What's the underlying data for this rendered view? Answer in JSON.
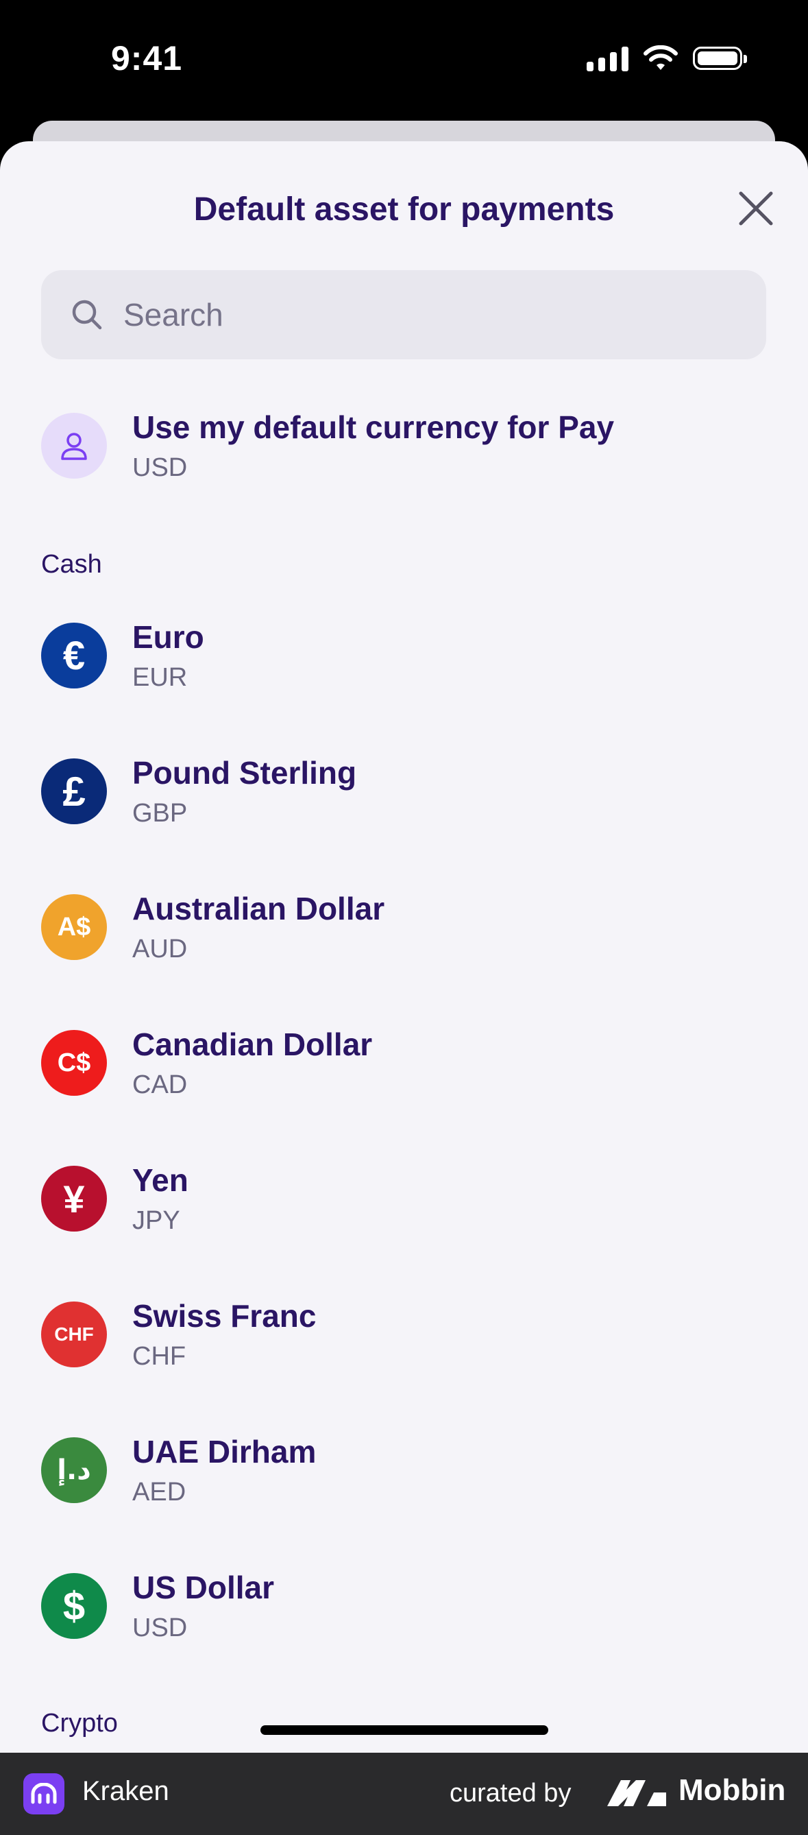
{
  "status_bar": {
    "time": "9:41"
  },
  "sheet": {
    "title": "Default asset for payments",
    "search": {
      "placeholder": "Search",
      "value": ""
    }
  },
  "default_option": {
    "label": "Use my default currency for Pay",
    "code": "USD",
    "icon": "person-icon"
  },
  "sections": {
    "cash": "Cash",
    "crypto": "Crypto"
  },
  "cash_items": [
    {
      "name": "Euro",
      "code": "EUR",
      "symbol": "€",
      "color": "#0a3d9c"
    },
    {
      "name": "Pound Sterling",
      "code": "GBP",
      "symbol": "£",
      "color": "#0a2a78"
    },
    {
      "name": "Australian Dollar",
      "code": "AUD",
      "symbol": "A$",
      "color": "#f0a32c"
    },
    {
      "name": "Canadian Dollar",
      "code": "CAD",
      "symbol": "C$",
      "color": "#ee1c1c"
    },
    {
      "name": "Yen",
      "code": "JPY",
      "symbol": "¥",
      "color": "#b8102e"
    },
    {
      "name": "Swiss Franc",
      "code": "CHF",
      "symbol": "CHF",
      "color": "#e03131"
    },
    {
      "name": "UAE Dirham",
      "code": "AED",
      "symbol": "د.إ",
      "color": "#3a8a3e"
    },
    {
      "name": "US Dollar",
      "code": "USD",
      "symbol": "$",
      "color": "#0f8a4a"
    }
  ],
  "footer": {
    "app_name": "Kraken",
    "curated_by": "curated by",
    "brand": "Mobbin"
  },
  "colors": {
    "title": "#2a1564",
    "sheet_bg": "#f5f4f9",
    "accent": "#7b3ff2"
  }
}
